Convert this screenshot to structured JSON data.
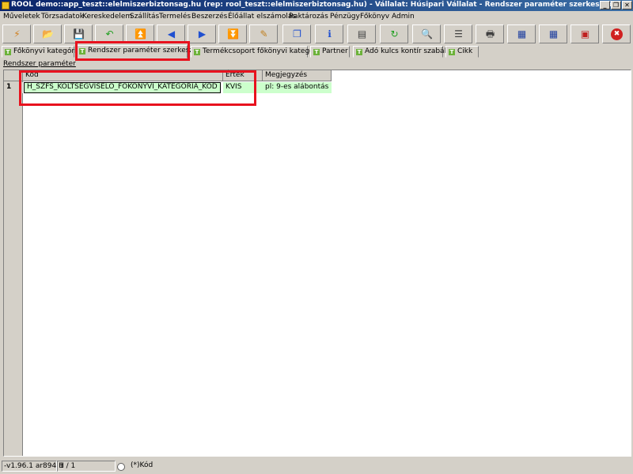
{
  "window": {
    "title": "ROOL demo::app_teszt::elelmiszerbiztonsag.hu (rep: rool_teszt::elelmiszerbiztonsag.hu) - Vállalat: Húsipari Vállalat - Rendszer paraméter szerkesztő",
    "buttons": {
      "minimize": "_",
      "restore": "❐",
      "close": "✕"
    }
  },
  "menu": [
    "Műveletek",
    "Törzsadatok",
    "Kereskedelem",
    "Szállítás",
    "Termelés",
    "Beszerzés",
    "Élőállat elszámolás",
    "Raktározás",
    "Pénzügy",
    "Főkönyv",
    "Admin"
  ],
  "toolbar": [
    {
      "icon": "lightning-icon",
      "glyph": "⚡",
      "color": "#d08020"
    },
    {
      "icon": "open-folder-icon",
      "glyph": "📂",
      "color": "#3060c0"
    },
    {
      "icon": "save-icon",
      "glyph": "💾",
      "color": "#304080"
    },
    {
      "icon": "undo-icon",
      "glyph": "↶",
      "color": "#20a020"
    },
    {
      "icon": "first-record-icon",
      "glyph": "⏫",
      "color": "#2050d0"
    },
    {
      "icon": "previous-record-icon",
      "glyph": "◀",
      "color": "#2050d0"
    },
    {
      "icon": "next-record-icon",
      "glyph": "▶",
      "color": "#2050d0"
    },
    {
      "icon": "last-record-icon",
      "glyph": "⏬",
      "color": "#2050d0"
    },
    {
      "icon": "edit-icon",
      "glyph": "✎",
      "color": "#c08020"
    },
    {
      "icon": "copy-icon",
      "glyph": "❐",
      "color": "#2050d0"
    },
    {
      "icon": "info-icon",
      "glyph": "ℹ",
      "color": "#2050d0"
    },
    {
      "icon": "form-view-icon",
      "glyph": "▤",
      "color": "#404040"
    },
    {
      "icon": "refresh-icon",
      "glyph": "↻",
      "color": "#20a020"
    },
    {
      "icon": "search-icon",
      "glyph": "🔍",
      "color": "#404040"
    },
    {
      "icon": "list-view-icon",
      "glyph": "☰",
      "color": "#404040"
    },
    {
      "icon": "print-icon",
      "glyph": "🖶",
      "color": "#404040"
    },
    {
      "icon": "table-export-icon",
      "glyph": "▦",
      "color": "#2040a0"
    },
    {
      "icon": "table-import-icon",
      "glyph": "▦",
      "color": "#2040a0"
    },
    {
      "icon": "window-icon",
      "glyph": "▣",
      "color": "#c02020"
    },
    {
      "icon": "close-icon",
      "glyph": "✖",
      "color": "#ffffff"
    }
  ],
  "tabs": [
    {
      "label": "Főkönyvi kategória",
      "icon": "T"
    },
    {
      "label": "Rendszer paraméter szerkesztő",
      "icon": "T"
    },
    {
      "label": "Termékcsoport főkönyvi kategória",
      "icon": "T"
    },
    {
      "label": "Partner",
      "icon": "T"
    },
    {
      "label": "Adó kulcs kontír szabály",
      "icon": "T"
    },
    {
      "label": "Cikk",
      "icon": "T"
    }
  ],
  "section_title": "Rendszer paraméter",
  "table": {
    "columns": [
      "Kód",
      "Érték",
      "Megjegyzés"
    ],
    "rows": [
      {
        "num": "1",
        "kod": "H_SZFS_KOLTSEGVISELO_FOKONYVI_KATEGORIA_KOD",
        "ertek": "KVIS",
        "megjegyzes": "pl: 9-es alábontás"
      }
    ]
  },
  "statusbar": {
    "version": "-v1.96.1 ar894 H",
    "record": "1 / 1",
    "sort": "(*)Kód"
  },
  "colors": {
    "highlight_box": "#e8121e",
    "row_fill": "#ccffcc",
    "titlebar": "#0a246a"
  }
}
